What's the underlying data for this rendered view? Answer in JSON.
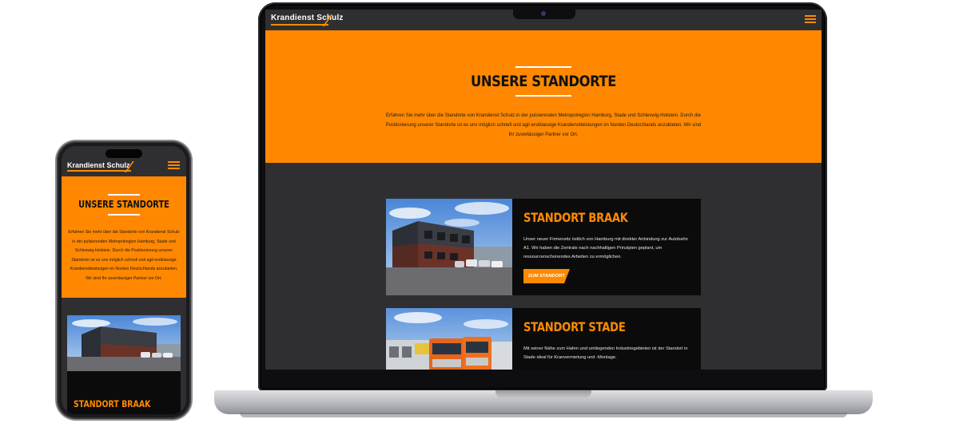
{
  "brand": {
    "logo_text": "Krandienst Schulz",
    "accent_color": "#ff8800",
    "dark_color": "#2f2f31"
  },
  "hero": {
    "title": "UNSERE STANDORTE",
    "text": "Erfahren Sie mehr über die Standorte von Krandienst Schulz in der pulsierenden Metropolregion Hamburg, Stade und Schleswig-Holstein. Durch die Positionierung unserer Standorte ist es uns möglich schnell und agil erstklassige Krandienstleistungen im Norden Deutschlands anzubieten. Wir sind Ihr zuverlässiger Partner vor Ort."
  },
  "locations": [
    {
      "title": "STANDORT BRAAK",
      "text": "Unser neuer Firmensitz östlich von Hamburg mit direkter Anbindung zur Autobahn A1. Wir haben die Zentrale nach nachhaltigen Prinzipien geplant, um ressourcenschonendes Arbeiten zu ermöglichen.",
      "button": "ZUM STANDORT"
    },
    {
      "title": "STANDORT STADE",
      "text": "Mit seiner Nähe zum Hafen und umliegenden Industriegebieten ist der Standort in Stade ideal für Kranvermietung und -Montage."
    }
  ],
  "icons": {
    "menu": "hamburger-menu-icon"
  }
}
